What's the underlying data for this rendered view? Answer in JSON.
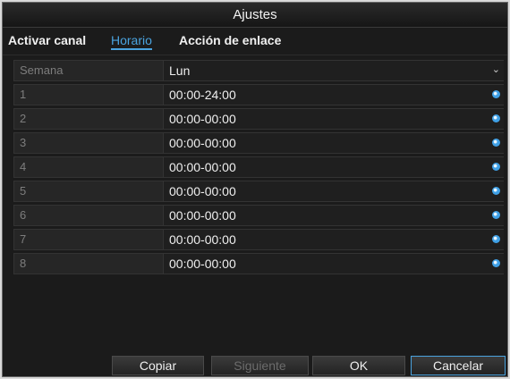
{
  "window": {
    "title": "Ajustes"
  },
  "tabs": [
    {
      "label": "Activar canal",
      "active": false
    },
    {
      "label": "Horario",
      "active": true
    },
    {
      "label": "Acción de enlace",
      "active": false
    }
  ],
  "schedule": {
    "week_label": "Semana",
    "week_value": "Lun",
    "rows": [
      {
        "index": "1",
        "time": "00:00-24:00"
      },
      {
        "index": "2",
        "time": "00:00-00:00"
      },
      {
        "index": "3",
        "time": "00:00-00:00"
      },
      {
        "index": "4",
        "time": "00:00-00:00"
      },
      {
        "index": "5",
        "time": "00:00-00:00"
      },
      {
        "index": "6",
        "time": "00:00-00:00"
      },
      {
        "index": "7",
        "time": "00:00-00:00"
      },
      {
        "index": "8",
        "time": "00:00-00:00"
      }
    ]
  },
  "buttons": {
    "copy": "Copiar",
    "next": "Siguiente",
    "ok": "OK",
    "cancel": "Cancelar"
  },
  "colors": {
    "accent": "#4aa3df",
    "background": "#1b1b1b"
  },
  "icons": {
    "row_action": "settings-dot-icon",
    "dropdown": "chevron-down-icon"
  }
}
